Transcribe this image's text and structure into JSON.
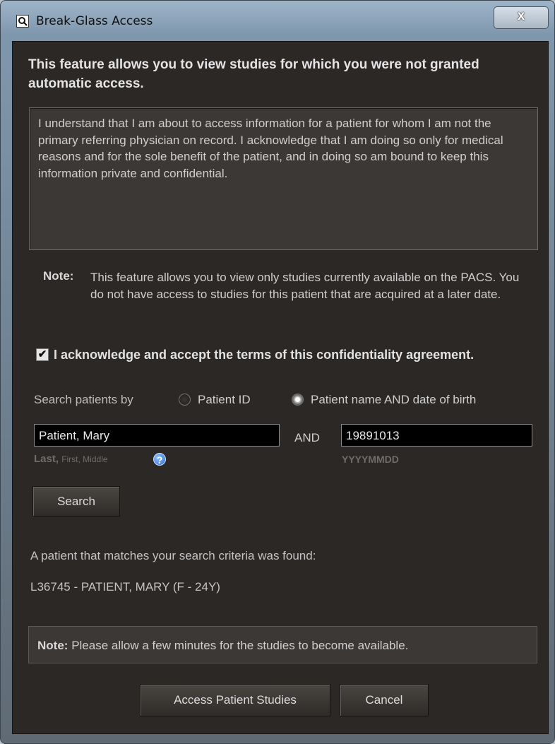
{
  "window": {
    "title": "Break-Glass Access",
    "close_glyph": "x",
    "icon": "magnifier-icon"
  },
  "dialog": {
    "heading": "This feature allows you to view studies for which you were not granted automatic access.",
    "agreement_text": "I understand that I am about to access information for a patient for whom I am not the primary referring physician on record. I acknowledge that I am doing so only for medical reasons and for the sole benefit of the patient, and in doing so am bound to keep this information private and confidential.",
    "note_label": "Note:",
    "note_text": "This feature allows you to view only studies currently available on the PACS. You do not have access to studies for this patient that are acquired at a later date.",
    "acknowledge_checked": true,
    "acknowledge_label": "I acknowledge and accept the terms of this confidentiality agreement."
  },
  "search": {
    "by_label": "Search patients by",
    "option_patient_id": "Patient ID",
    "option_name_dob": "Patient name AND date of birth",
    "selected_option": "Patient name AND date of birth",
    "name_value": "Patient, Mary",
    "and_label": "AND",
    "dob_value": "19891013",
    "name_hint_last": "Last,",
    "name_hint_first_middle": "First, Middle",
    "dob_hint": "YYYYMMDD",
    "search_button": "Search"
  },
  "result": {
    "found_text": "A patient that matches your search criteria was found:",
    "patient_text": "L36745 - PATIENT, MARY (F - 24Y)"
  },
  "note2": {
    "label": "Note:",
    "text": "Please allow a few minutes for the studies to become available."
  },
  "buttons": {
    "access": "Access Patient Studies",
    "cancel": "Cancel"
  }
}
